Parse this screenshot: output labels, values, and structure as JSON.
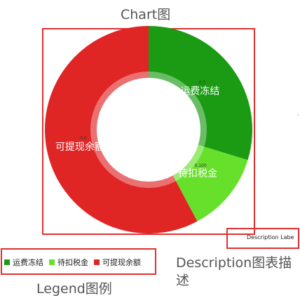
{
  "annotations": {
    "chart_title": "Chart图",
    "description_title_line1": "Description图表描",
    "description_title_line2": "述",
    "legend_title": "Legend图例"
  },
  "description_label": "Description Labe",
  "colors": {
    "annotation_border": "#e03030",
    "freeze": "#1a9b13",
    "withhold": "#66e02a",
    "withdrawable": "#e02525"
  },
  "chart_data": {
    "type": "pie",
    "series": [
      {
        "name": "运费冻结",
        "value_label": "0.3",
        "color": "#1a9b13"
      },
      {
        "name": "待扣税金",
        "value_label": "0.100",
        "color": "#66e02a"
      },
      {
        "name": "可提现余额",
        "value_label": "0.6",
        "color": "#e02525"
      }
    ]
  },
  "legend": [
    {
      "label": "运费冻结",
      "color": "#1a9b13"
    },
    {
      "label": "待扣税金",
      "color": "#66e02a"
    },
    {
      "label": "可提现余额",
      "color": "#e02525"
    }
  ]
}
